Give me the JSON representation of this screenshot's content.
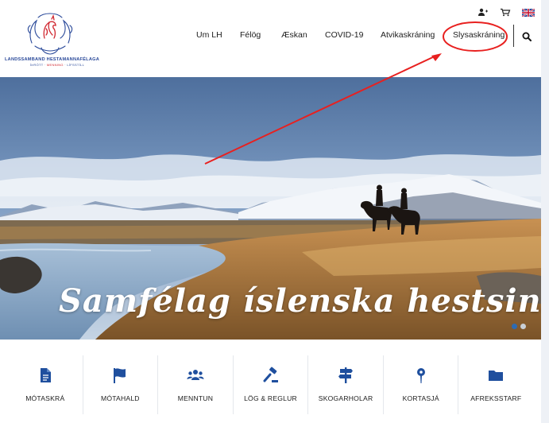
{
  "logo": {
    "name": "LANDSSAMBAND HESTAMANNAFÉLAGA",
    "tagline_parts": [
      "ÍÞRÓTT · ",
      "MENNING",
      " · LÍFSSTÍLL"
    ]
  },
  "utility": {
    "icons": [
      "user-icon",
      "cart-icon",
      "uk-flag-icon"
    ]
  },
  "nav": {
    "items": [
      "Um LH",
      "Félög",
      "Æskan",
      "COVID-19",
      "Atvikaskráning",
      "Slysaskráning"
    ],
    "highlighted": "Slysaskráning",
    "search_icon": "search-icon"
  },
  "hero": {
    "title": "Samfélag íslenska hestsins",
    "slides_total": 2,
    "active_slide": 1
  },
  "quick_links": [
    {
      "label": "MÓTASKRÁ",
      "icon": "document-icon"
    },
    {
      "label": "MÓTAHALD",
      "icon": "flag-icon"
    },
    {
      "label": "MENNTUN",
      "icon": "users-icon"
    },
    {
      "label": "LÖG & REGLUR",
      "icon": "gavel-icon"
    },
    {
      "label": "SKOGARHOLAR",
      "icon": "signpost-icon"
    },
    {
      "label": "KORTASJÁ",
      "icon": "map-pin-icon"
    },
    {
      "label": "AFREKSSTARF",
      "icon": "folder-icon"
    }
  ],
  "colors": {
    "brand_blue": "#2b4a9a",
    "icon_blue": "#1f4f9e",
    "annotation_red": "#e8201f",
    "slider_active": "#2d6bb3"
  }
}
